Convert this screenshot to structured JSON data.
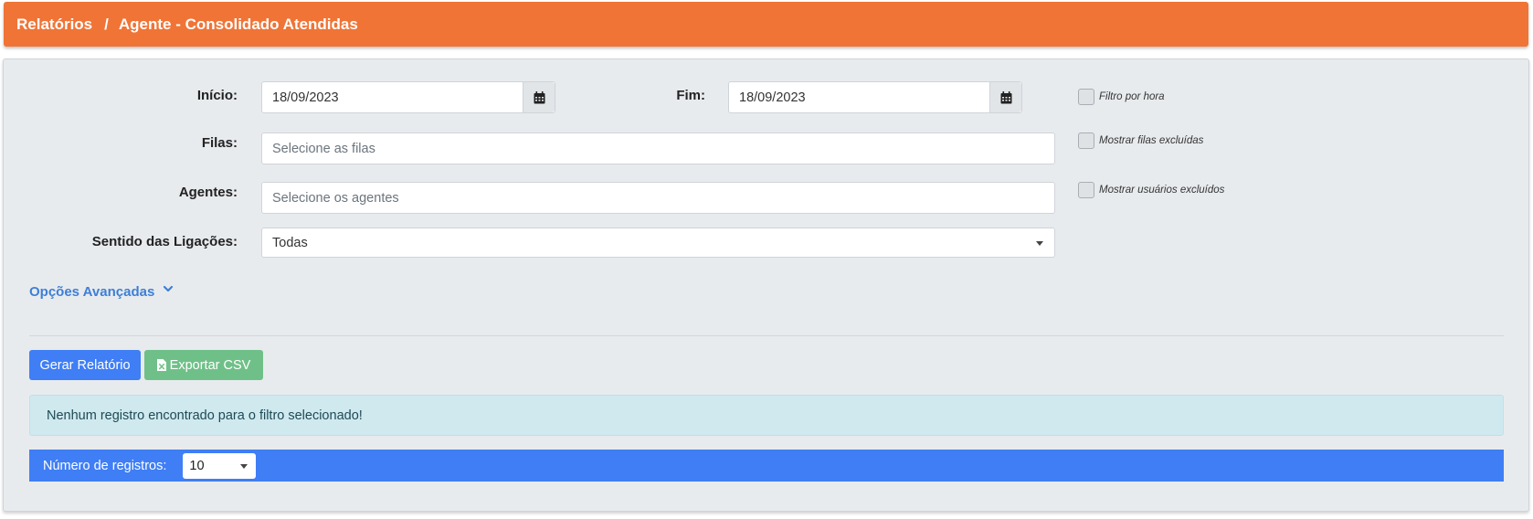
{
  "breadcrumb": {
    "root": "Relatórios",
    "separator": "/",
    "current": "Agente - Consolidado Atendidas"
  },
  "form": {
    "inicio_label": "Início:",
    "inicio_value": "18/09/2023",
    "fim_label": "Fim:",
    "fim_value": "18/09/2023",
    "filtro_hora_label": "Filtro por hora",
    "filas_label": "Filas:",
    "filas_placeholder": "Selecione as filas",
    "mostrar_filas_label": "Mostrar filas excluídas",
    "agentes_label": "Agentes:",
    "agentes_placeholder": "Selecione os agentes",
    "mostrar_usuarios_label": "Mostrar usuários excluídos",
    "sentido_label": "Sentido das Ligações:",
    "sentido_value": "Todas"
  },
  "advanced": {
    "label": "Opções Avançadas",
    "icon": "chevron-down-icon"
  },
  "actions": {
    "generate_label": "Gerar Relatório",
    "export_label": "Exportar CSV",
    "export_icon": "file-excel-icon"
  },
  "alert": {
    "message": "Nenhum registro encontrado para o filtro selecionado!"
  },
  "records": {
    "label": "Número de registros:",
    "value": "10"
  },
  "colors": {
    "header": "#f07436",
    "primary": "#3f7ef5",
    "success": "#6fc088",
    "info_bg": "#d0e9ef",
    "link": "#3d7fd6"
  }
}
